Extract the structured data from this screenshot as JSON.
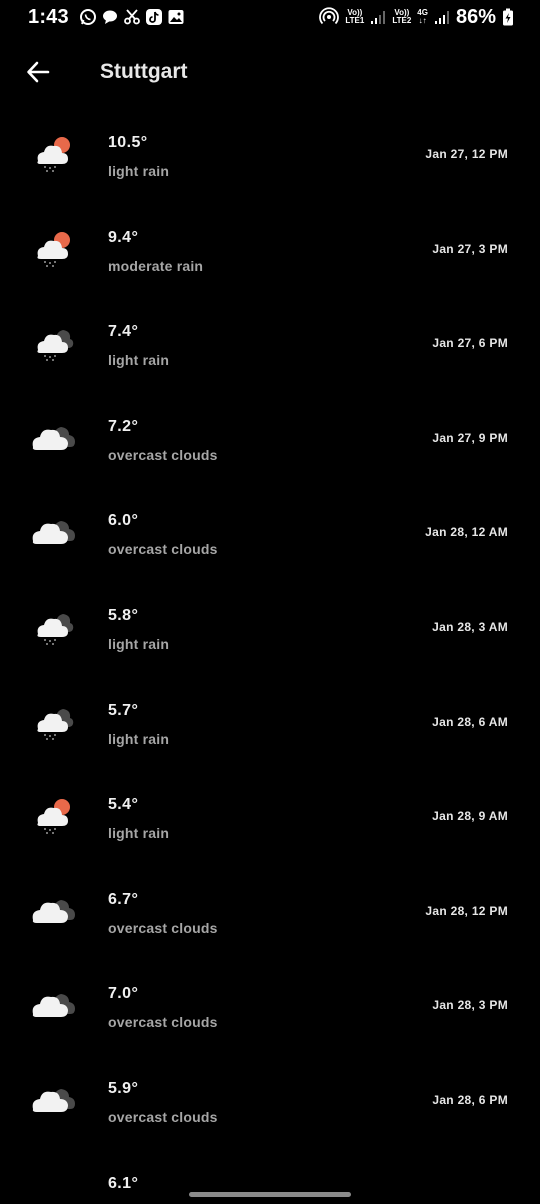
{
  "status_bar": {
    "time": "1:43",
    "battery": "86%",
    "sim1_top": "Vo))",
    "sim1_bottom": "LTE1",
    "sim2_top": "Vo))",
    "sim2_bottom": "LTE2",
    "net_type": "4G"
  },
  "header": {
    "title": "Stuttgart"
  },
  "forecasts": [
    {
      "temp": "10.5°",
      "desc": "light rain",
      "time": "Jan 27, 12 PM",
      "icon": "sun-cloud-rain-icon"
    },
    {
      "temp": "9.4°",
      "desc": "moderate rain",
      "time": "Jan 27, 3 PM",
      "icon": "sun-cloud-rain-icon"
    },
    {
      "temp": "7.4°",
      "desc": "light rain",
      "time": "Jan 27, 6 PM",
      "icon": "cloud-rain-icon"
    },
    {
      "temp": "7.2°",
      "desc": "overcast clouds",
      "time": "Jan 27, 9 PM",
      "icon": "overcast-clouds-icon"
    },
    {
      "temp": "6.0°",
      "desc": "overcast clouds",
      "time": "Jan 28, 12 AM",
      "icon": "overcast-clouds-icon"
    },
    {
      "temp": "5.8°",
      "desc": "light rain",
      "time": "Jan 28, 3 AM",
      "icon": "cloud-rain-icon"
    },
    {
      "temp": "5.7°",
      "desc": "light rain",
      "time": "Jan 28, 6 AM",
      "icon": "cloud-rain-icon"
    },
    {
      "temp": "5.4°",
      "desc": "light rain",
      "time": "Jan 28, 9 AM",
      "icon": "sun-cloud-rain-icon"
    },
    {
      "temp": "6.7°",
      "desc": "overcast clouds",
      "time": "Jan 28, 12 PM",
      "icon": "overcast-clouds-icon"
    },
    {
      "temp": "7.0°",
      "desc": "overcast clouds",
      "time": "Jan 28, 3 PM",
      "icon": "overcast-clouds-icon"
    },
    {
      "temp": "5.9°",
      "desc": "overcast clouds",
      "time": "Jan 28, 6 PM",
      "icon": "overcast-clouds-icon"
    }
  ],
  "partial_row": {
    "temp": "6.1°"
  },
  "colors": {
    "background": "#000000",
    "sun": "#e8694a",
    "cloud_front": "#f2f2f2",
    "cloud_back": "#4a4a4a",
    "secondary_text": "#a6a6a6"
  }
}
